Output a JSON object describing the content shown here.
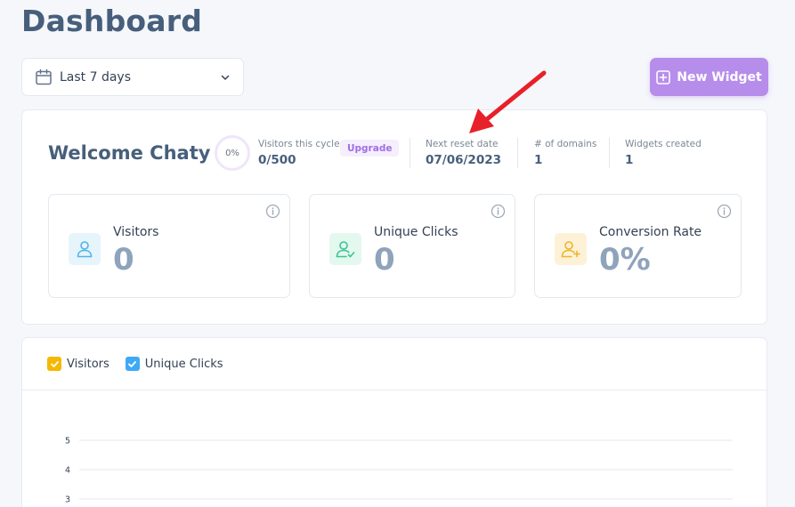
{
  "page": {
    "title": "Dashboard"
  },
  "date_filter": {
    "label": "Last 7 days",
    "icon": "calendar-icon"
  },
  "new_widget": {
    "label": "New Widget",
    "icon": "plus-square-icon"
  },
  "welcome": {
    "title": "Welcome Chaty",
    "progress": {
      "percent_label": "0%",
      "fraction": 0
    },
    "stats": [
      {
        "label": "Visitors this cycle",
        "value": "0/500"
      },
      {
        "label": "Next reset date",
        "value": "07/06/2023"
      },
      {
        "label": "# of domains",
        "value": "1"
      },
      {
        "label": "Widgets created",
        "value": "1"
      }
    ],
    "upgrade_label": "Upgrade"
  },
  "metrics": [
    {
      "label": "Visitors",
      "value": "0",
      "icon": "user-icon",
      "color": "#4fb3e8",
      "bg": "#e6f4fc"
    },
    {
      "label": "Unique Clicks",
      "value": "0",
      "icon": "user-check-icon",
      "color": "#3cc48d",
      "bg": "#e3f8ef"
    },
    {
      "label": "Conversion Rate",
      "value": "0%",
      "icon": "user-plus-icon",
      "color": "#f0b429",
      "bg": "#fdf1d8"
    }
  ],
  "chart_data": {
    "type": "line",
    "series": [
      {
        "name": "Visitors",
        "color": "#f5b800",
        "values": []
      },
      {
        "name": "Unique Clicks",
        "color": "#3fa9f5",
        "values": []
      }
    ],
    "y_ticks": [
      "5",
      "4",
      "3"
    ],
    "ylim": [
      0,
      5
    ],
    "grid": true,
    "legend": "top-left"
  },
  "colors": {
    "accent": "#b78deb",
    "title": "#475f7b",
    "annotation_arrow": "#e8202a"
  }
}
